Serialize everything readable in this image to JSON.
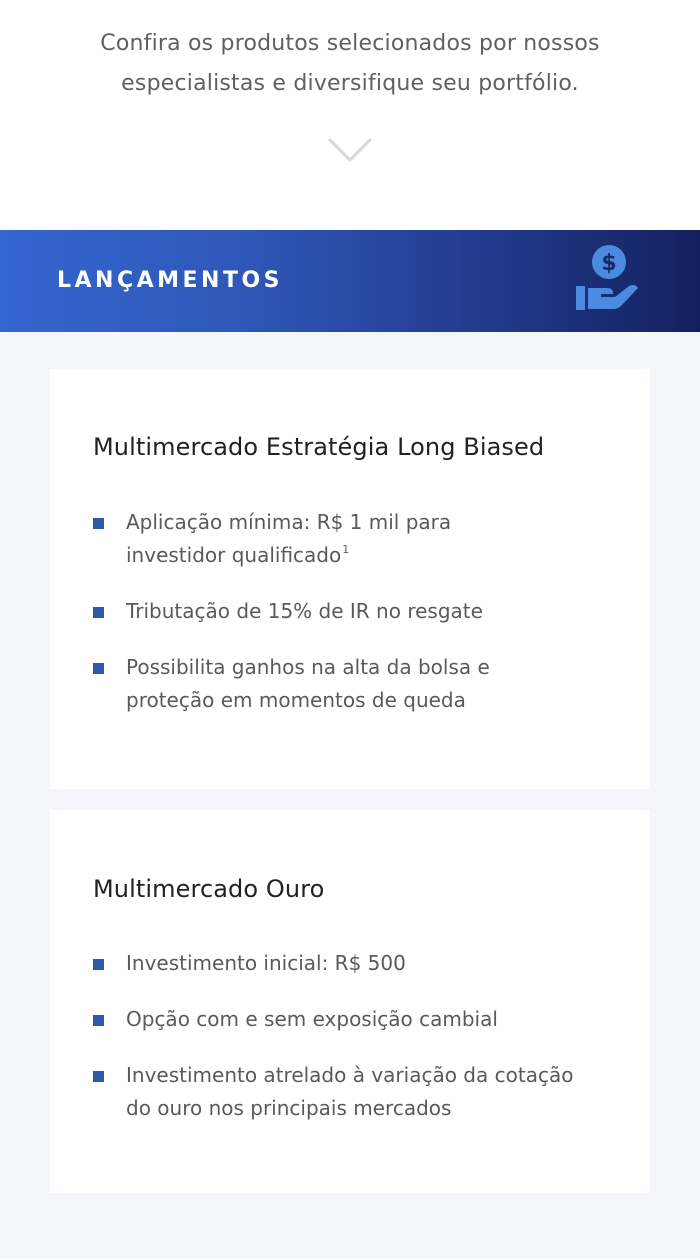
{
  "intro": {
    "line1": "Confira os produtos selecionados por nossos",
    "line2": "especialistas e diversifique seu portfólio."
  },
  "icons": {
    "chevron": "chevron-down-icon",
    "money": "hand-coin-dollar-icon"
  },
  "colors": {
    "banner_start": "#3466d0",
    "banner_end": "#14205e",
    "bullet": "#2f5aaa",
    "page_bg": "#f4f6f9"
  },
  "banner": {
    "title": "LANÇAMENTOS"
  },
  "cards": [
    {
      "title": "Multimercado Estratégia Long Biased",
      "features": [
        {
          "line1": "Aplicação mínima: R$ 1 mil para",
          "line2": "investidor qualificado",
          "footnote": "1"
        },
        {
          "line1": "Tributação de 15% de IR no resgate"
        },
        {
          "line1": "Possibilita ganhos na alta da bolsa e",
          "line2": "proteção em momentos de queda"
        }
      ]
    },
    {
      "title": "Multimercado Ouro",
      "features": [
        {
          "line1": "Investimento inicial: R$ 500"
        },
        {
          "line1": "Opção com e sem exposição cambial"
        },
        {
          "line1": "Investimento atrelado à variação da cotação",
          "line2": "do ouro nos principais mercados"
        }
      ]
    }
  ]
}
